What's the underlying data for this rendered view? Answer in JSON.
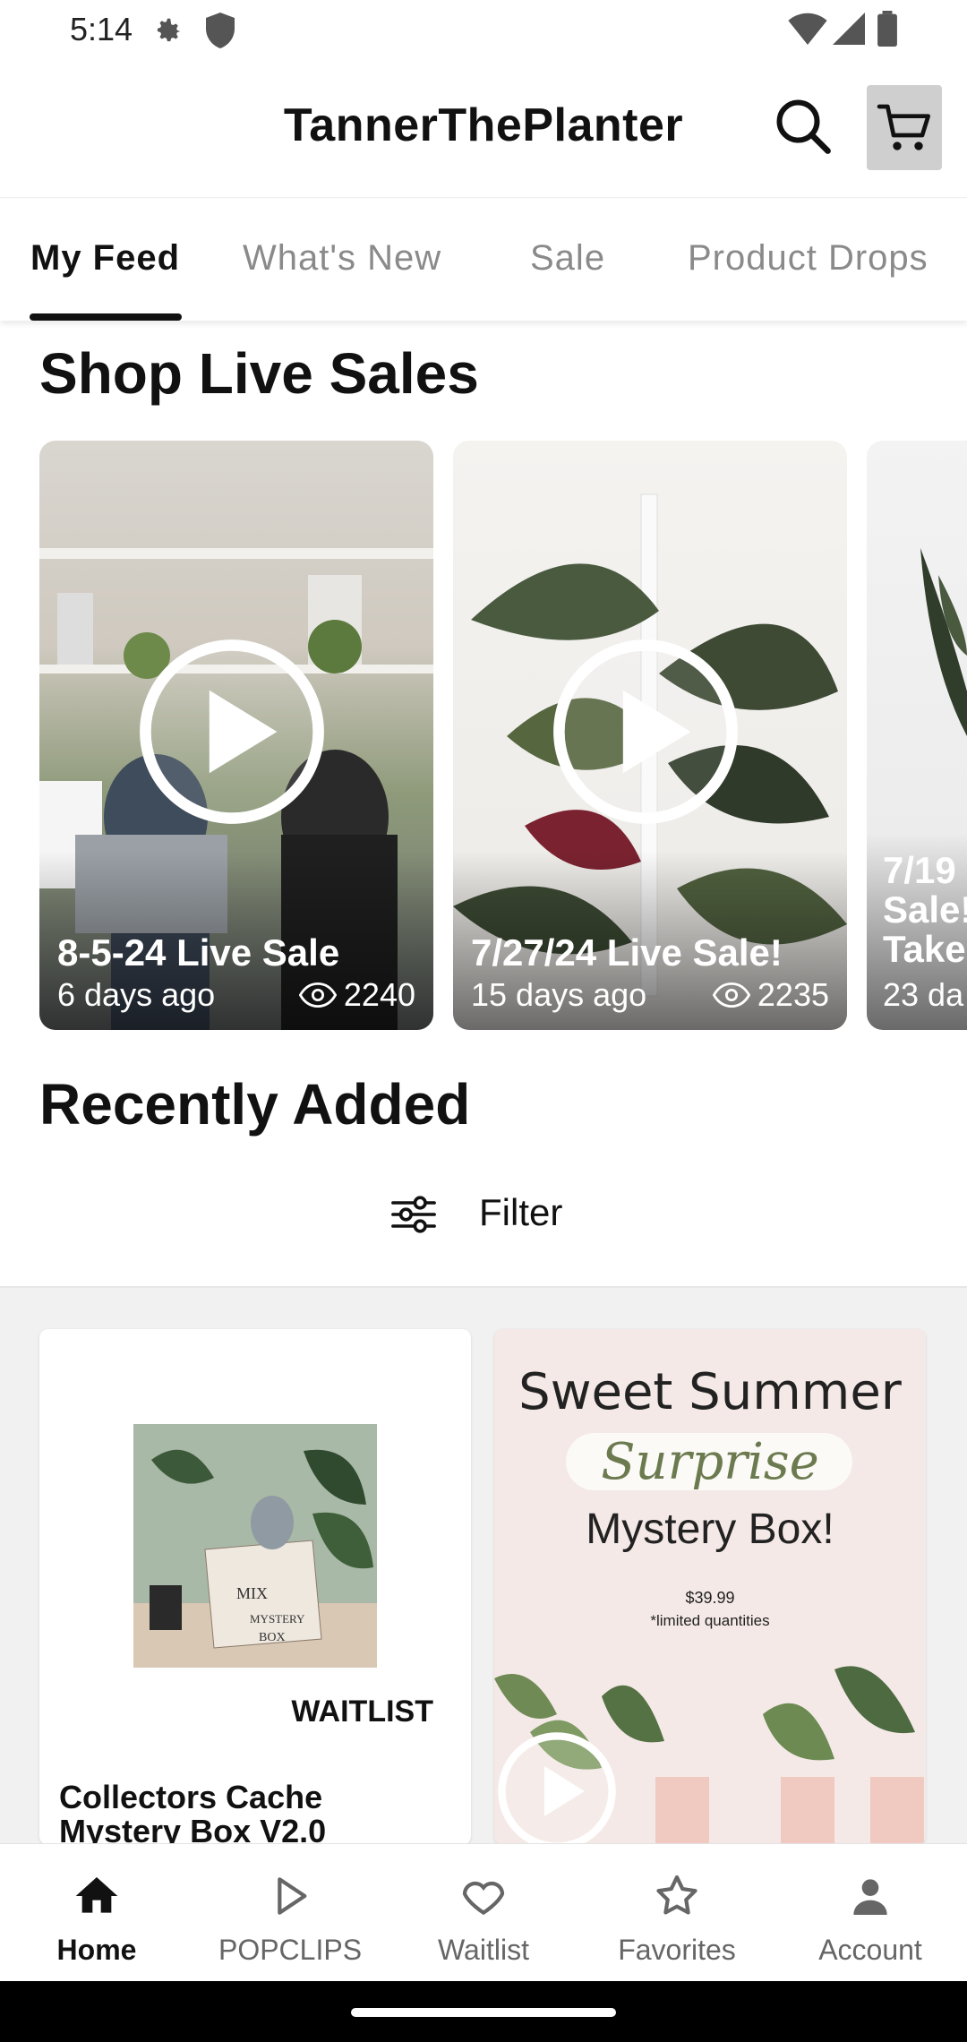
{
  "status_bar": {
    "time": "5:14"
  },
  "header": {
    "brand": "TannerThePlanter"
  },
  "tabs": [
    {
      "label": "My Feed"
    },
    {
      "label": "What's New"
    },
    {
      "label": "Sale"
    },
    {
      "label": "Product Drops"
    }
  ],
  "live": {
    "title": "Shop Live Sales",
    "cards": [
      {
        "title": "8-5-24 Live Sale",
        "date": "6 days ago",
        "views": "2240"
      },
      {
        "title": "7/27/24 Live Sale!",
        "date": "15 days ago",
        "views": "2235"
      },
      {
        "title_lines": [
          "7/19",
          "Sale!",
          "Take"
        ],
        "date": "23 da"
      }
    ]
  },
  "recent": {
    "title": "Recently Added",
    "filter_label": "Filter",
    "products": [
      {
        "badge": "WAITLIST",
        "name": "Collectors Cache Mystery Box V2.0",
        "box_text": [
          "MIX",
          "MYSTERY",
          "BOX"
        ]
      },
      {
        "headline": "Sweet Summer",
        "script": "Surprise",
        "subhead": "Mystery Box!",
        "price": "$39.99",
        "note": "*limited quantities"
      }
    ]
  },
  "nav": [
    {
      "label": "Home"
    },
    {
      "label": "POPCLIPS"
    },
    {
      "label": "Waitlist"
    },
    {
      "label": "Favorites"
    },
    {
      "label": "Account"
    }
  ]
}
